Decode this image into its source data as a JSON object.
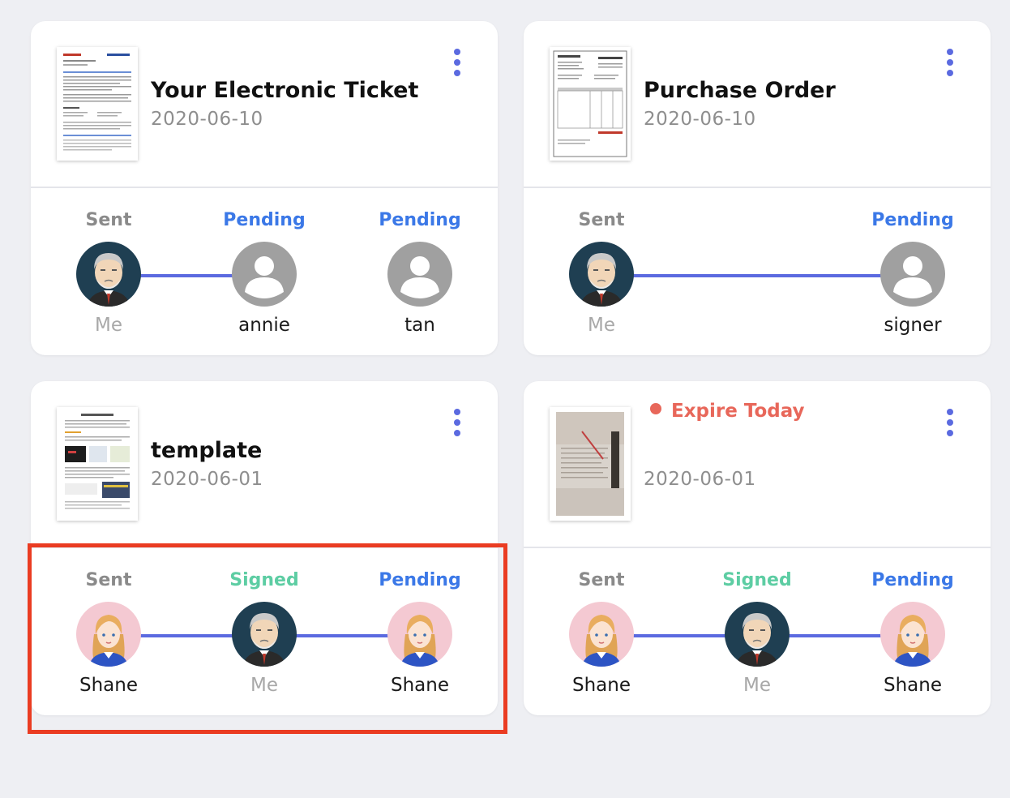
{
  "colors": {
    "sent": "#8a8a8a",
    "pending": "#3b78e7",
    "signed": "#5dcda3",
    "expire": "#e8675a",
    "line": "#5b6ae0",
    "more": "#5b6ae0",
    "me_name": "#a8a8a8",
    "name": "#1a1a1a",
    "highlight": "#ea3c22"
  },
  "documents": [
    {
      "title": "Your Electronic Ticket...",
      "date": "2020-06-10",
      "expire": "",
      "thumbnail": "ticket-thumbnail",
      "signers": [
        {
          "status": "Sent",
          "status_key": "sent",
          "name": "Me",
          "avatar": "old-man-avatar"
        },
        {
          "status": "Pending",
          "status_key": "pending",
          "name": "annie",
          "avatar": "person-placeholder-icon"
        },
        {
          "status": "Pending",
          "status_key": "pending",
          "name": "tan",
          "avatar": "person-placeholder-icon"
        }
      ]
    },
    {
      "title": "Purchase Order",
      "date": "2020-06-10",
      "expire": "",
      "thumbnail": "purchase-order-thumbnail",
      "signers": [
        {
          "status": "Sent",
          "status_key": "sent",
          "name": "Me",
          "avatar": "old-man-avatar"
        },
        {
          "status": "Pending",
          "status_key": "pending",
          "name": "signer",
          "avatar": "person-placeholder-icon"
        }
      ]
    },
    {
      "title": "template",
      "date": "2020-06-01",
      "expire": "",
      "thumbnail": "template-thumbnail",
      "signers": [
        {
          "status": "Sent",
          "status_key": "sent",
          "name": "Shane",
          "avatar": "woman-avatar"
        },
        {
          "status": "Signed",
          "status_key": "signed",
          "name": "Me",
          "avatar": "old-man-avatar"
        },
        {
          "status": "Pending",
          "status_key": "pending",
          "name": "Shane",
          "avatar": "woman-avatar"
        }
      ]
    },
    {
      "title": "",
      "date": "2020-06-01",
      "expire": "Expire Today",
      "thumbnail": "photo-thumbnail",
      "signers": [
        {
          "status": "Sent",
          "status_key": "sent",
          "name": "Shane",
          "avatar": "woman-avatar"
        },
        {
          "status": "Signed",
          "status_key": "signed",
          "name": "Me",
          "avatar": "old-man-avatar"
        },
        {
          "status": "Pending",
          "status_key": "pending",
          "name": "Shane",
          "avatar": "woman-avatar"
        }
      ]
    }
  ]
}
